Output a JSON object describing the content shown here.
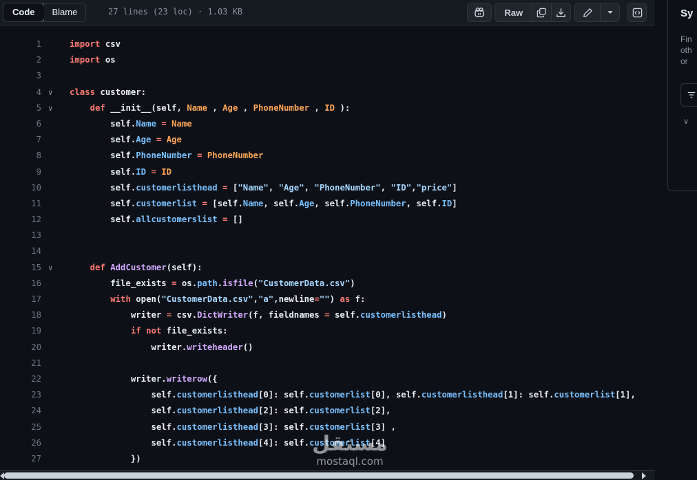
{
  "toolbar": {
    "code_label": "Code",
    "blame_label": "Blame",
    "file_info": "27 lines (23 loc) · 1.03 KB",
    "raw_label": "Raw"
  },
  "sidebar": {
    "title": "Sy",
    "desc_lines": [
      "Fin",
      "oth",
      "or"
    ]
  },
  "watermark": {
    "arabic": "مستقل",
    "latin": "mostaql.com"
  },
  "colors": {
    "background": "#0d1117",
    "keyword": "#ff7b72",
    "property": "#79c0ff",
    "string": "#a5d6ff",
    "function": "#d2a8ff",
    "variable": "#ffa657"
  },
  "code": {
    "lines": [
      {
        "n": "1",
        "fold": "",
        "t": [
          [
            "k",
            "import"
          ],
          [
            "w",
            " csv"
          ]
        ]
      },
      {
        "n": "2",
        "fold": "",
        "t": [
          [
            "k",
            "import"
          ],
          [
            "w",
            " os"
          ]
        ]
      },
      {
        "n": "3",
        "fold": "",
        "t": []
      },
      {
        "n": "4",
        "fold": "∨",
        "t": [
          [
            "k",
            "class"
          ],
          [
            "w",
            " customer:"
          ]
        ]
      },
      {
        "n": "5",
        "fold": "∨",
        "t": [
          [
            "w",
            "    "
          ],
          [
            "k",
            "def"
          ],
          [
            "w",
            " __init__(self, "
          ],
          [
            "v",
            "Name"
          ],
          [
            "w",
            " , "
          ],
          [
            "v",
            "Age"
          ],
          [
            "w",
            " , "
          ],
          [
            "v",
            "PhoneNumber"
          ],
          [
            "w",
            " , "
          ],
          [
            "v",
            "ID"
          ],
          [
            "w",
            " ):"
          ]
        ]
      },
      {
        "n": "6",
        "fold": "",
        "t": [
          [
            "w",
            "        self."
          ],
          [
            "p",
            "Name"
          ],
          [
            "w",
            " "
          ],
          [
            "k",
            "="
          ],
          [
            "w",
            " "
          ],
          [
            "v",
            "Name"
          ]
        ]
      },
      {
        "n": "7",
        "fold": "",
        "t": [
          [
            "w",
            "        self."
          ],
          [
            "p",
            "Age"
          ],
          [
            "w",
            " "
          ],
          [
            "k",
            "="
          ],
          [
            "w",
            " "
          ],
          [
            "v",
            "Age"
          ]
        ]
      },
      {
        "n": "8",
        "fold": "",
        "t": [
          [
            "w",
            "        self."
          ],
          [
            "p",
            "PhoneNumber"
          ],
          [
            "w",
            " "
          ],
          [
            "k",
            "="
          ],
          [
            "w",
            " "
          ],
          [
            "v",
            "PhoneNumber"
          ]
        ]
      },
      {
        "n": "9",
        "fold": "",
        "t": [
          [
            "w",
            "        self."
          ],
          [
            "p",
            "ID"
          ],
          [
            "w",
            " "
          ],
          [
            "k",
            "="
          ],
          [
            "w",
            " "
          ],
          [
            "v",
            "ID"
          ]
        ]
      },
      {
        "n": "10",
        "fold": "",
        "t": [
          [
            "w",
            "        self."
          ],
          [
            "p",
            "customerlisthead"
          ],
          [
            "w",
            " "
          ],
          [
            "k",
            "="
          ],
          [
            "w",
            " ["
          ],
          [
            "s",
            "\"Name\""
          ],
          [
            "w",
            ", "
          ],
          [
            "s",
            "\"Age\""
          ],
          [
            "w",
            ", "
          ],
          [
            "s",
            "\"PhoneNumber\""
          ],
          [
            "w",
            ", "
          ],
          [
            "s",
            "\"ID\""
          ],
          [
            "w",
            ","
          ],
          [
            "s",
            "\"price\""
          ],
          [
            "w",
            "]"
          ]
        ]
      },
      {
        "n": "11",
        "fold": "",
        "t": [
          [
            "w",
            "        self."
          ],
          [
            "p",
            "customerlist"
          ],
          [
            "w",
            " "
          ],
          [
            "k",
            "="
          ],
          [
            "w",
            " [self."
          ],
          [
            "p",
            "Name"
          ],
          [
            "w",
            ", self."
          ],
          [
            "p",
            "Age"
          ],
          [
            "w",
            ", self."
          ],
          [
            "p",
            "PhoneNumber"
          ],
          [
            "w",
            ", self."
          ],
          [
            "p",
            "ID"
          ],
          [
            "w",
            "]"
          ]
        ]
      },
      {
        "n": "12",
        "fold": "",
        "t": [
          [
            "w",
            "        self."
          ],
          [
            "p",
            "allcustomerslist"
          ],
          [
            "w",
            " "
          ],
          [
            "k",
            "="
          ],
          [
            "w",
            " []"
          ]
        ]
      },
      {
        "n": "13",
        "fold": "",
        "t": []
      },
      {
        "n": "14",
        "fold": "",
        "t": []
      },
      {
        "n": "15",
        "fold": "∨",
        "t": [
          [
            "w",
            "    "
          ],
          [
            "k",
            "def"
          ],
          [
            "w",
            " "
          ],
          [
            "fn",
            "AddCustomer"
          ],
          [
            "w",
            "(self):"
          ]
        ]
      },
      {
        "n": "16",
        "fold": "",
        "t": [
          [
            "w",
            "        file_exists "
          ],
          [
            "k",
            "="
          ],
          [
            "w",
            " os."
          ],
          [
            "p",
            "path"
          ],
          [
            "w",
            "."
          ],
          [
            "fn",
            "isfile"
          ],
          [
            "w",
            "("
          ],
          [
            "s",
            "\"CustomerData.csv\""
          ],
          [
            "w",
            ")"
          ]
        ]
      },
      {
        "n": "17",
        "fold": "",
        "t": [
          [
            "w",
            "        "
          ],
          [
            "k",
            "with"
          ],
          [
            "w",
            " open("
          ],
          [
            "s",
            "\"CustomerData.csv\""
          ],
          [
            "w",
            ","
          ],
          [
            "s",
            "\"a\""
          ],
          [
            "w",
            ",newline"
          ],
          [
            "k",
            "="
          ],
          [
            "s",
            "\"\""
          ],
          [
            "w",
            ") "
          ],
          [
            "k",
            "as"
          ],
          [
            "w",
            " f:"
          ]
        ]
      },
      {
        "n": "18",
        "fold": "",
        "t": [
          [
            "w",
            "            writer "
          ],
          [
            "k",
            "="
          ],
          [
            "w",
            " csv."
          ],
          [
            "fn",
            "DictWriter"
          ],
          [
            "w",
            "(f, fieldnames "
          ],
          [
            "k",
            "="
          ],
          [
            "w",
            " self."
          ],
          [
            "p",
            "customerlisthead"
          ],
          [
            "w",
            ")"
          ]
        ]
      },
      {
        "n": "19",
        "fold": "",
        "t": [
          [
            "w",
            "            "
          ],
          [
            "k",
            "if"
          ],
          [
            "w",
            " "
          ],
          [
            "k",
            "not"
          ],
          [
            "w",
            " file_exists:"
          ]
        ]
      },
      {
        "n": "20",
        "fold": "",
        "t": [
          [
            "w",
            "                writer."
          ],
          [
            "fn",
            "writeheader"
          ],
          [
            "w",
            "()"
          ]
        ]
      },
      {
        "n": "21",
        "fold": "",
        "t": []
      },
      {
        "n": "22",
        "fold": "",
        "t": [
          [
            "w",
            "            writer."
          ],
          [
            "fn",
            "writerow"
          ],
          [
            "w",
            "({"
          ]
        ]
      },
      {
        "n": "23",
        "fold": "",
        "t": [
          [
            "w",
            "                self."
          ],
          [
            "p",
            "customerlisthead"
          ],
          [
            "w",
            "[0]: self."
          ],
          [
            "p",
            "customerlist"
          ],
          [
            "w",
            "[0], self."
          ],
          [
            "p",
            "customerlisthead"
          ],
          [
            "w",
            "[1]: self."
          ],
          [
            "p",
            "customerlist"
          ],
          [
            "w",
            "[1],"
          ]
        ]
      },
      {
        "n": "24",
        "fold": "",
        "t": [
          [
            "w",
            "                self."
          ],
          [
            "p",
            "customerlisthead"
          ],
          [
            "w",
            "[2]: self."
          ],
          [
            "p",
            "customerlist"
          ],
          [
            "w",
            "[2],"
          ]
        ]
      },
      {
        "n": "25",
        "fold": "",
        "t": [
          [
            "w",
            "                self."
          ],
          [
            "p",
            "customerlisthead"
          ],
          [
            "w",
            "[3]: self."
          ],
          [
            "p",
            "customerlist"
          ],
          [
            "w",
            "[3] ,"
          ]
        ]
      },
      {
        "n": "26",
        "fold": "",
        "t": [
          [
            "w",
            "                self."
          ],
          [
            "p",
            "customerlisthead"
          ],
          [
            "w",
            "[4]: self."
          ],
          [
            "p",
            "customerlist"
          ],
          [
            "w",
            "[4]"
          ]
        ]
      },
      {
        "n": "27",
        "fold": "",
        "t": [
          [
            "w",
            "            })"
          ]
        ]
      }
    ]
  }
}
